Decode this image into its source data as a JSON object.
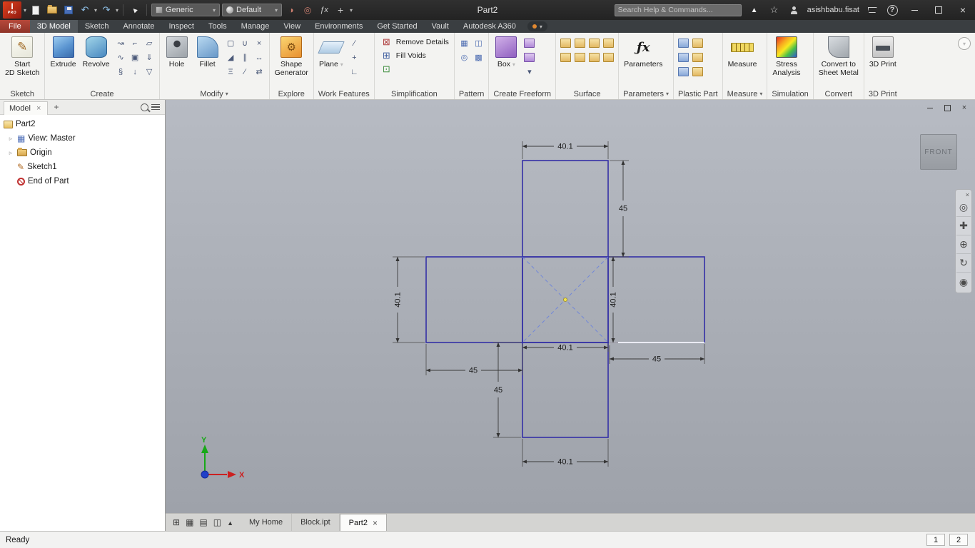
{
  "titlebar": {
    "logo": "I",
    "logo_sub": "PRO",
    "doc_title": "Part2",
    "search_placeholder": "Search Help & Commands...",
    "user_name": "asishbabu.fisat",
    "material_value": "Generic",
    "appearance_value": "Default"
  },
  "icons": {
    "note": "semantic icon names are carried on data-name attributes; glyphs/CSS shapes map them visually",
    "search": "magnifier",
    "menu": "hamburger",
    "close": "x",
    "undo": "arrow-curl-left",
    "redo": "arrow-curl-right",
    "favorites": "star",
    "help": "question-circle",
    "navigation_wheel": "wheel",
    "pan": "cross",
    "zoom": "plus-circle",
    "orbit": "circular-arrow",
    "look_at": "eye-dot"
  },
  "tabs": {
    "file": "File",
    "items": [
      "3D Model",
      "Sketch",
      "Annotate",
      "Inspect",
      "Tools",
      "Manage",
      "View",
      "Environments",
      "Get Started",
      "Vault",
      "Autodesk A360"
    ],
    "active": "3D Model"
  },
  "ribbon": {
    "sketch": {
      "label": "Sketch",
      "start1": "Start",
      "start2": "2D Sketch"
    },
    "create": {
      "label": "Create",
      "extrude": "Extrude",
      "revolve": "Revolve"
    },
    "modify": {
      "label": "Modify",
      "hole": "Hole",
      "fillet": "Fillet"
    },
    "explore": {
      "label": "Explore",
      "sg1": "Shape",
      "sg2": "Generator"
    },
    "work": {
      "label": "Work Features",
      "plane": "Plane"
    },
    "simplify": {
      "label": "Simplification",
      "remove": "Remove Details",
      "fill": "Fill Voids"
    },
    "pattern": {
      "label": "Pattern"
    },
    "freeform": {
      "label": "Create Freeform",
      "box": "Box"
    },
    "surface": {
      "label": "Surface"
    },
    "parameters": {
      "label": "Parameters",
      "btn": "Parameters"
    },
    "plastic": {
      "label": "Plastic Part"
    },
    "measure": {
      "label": "Measure",
      "btn": "Measure"
    },
    "simulation": {
      "label": "Simulation",
      "s1": "Stress",
      "s2": "Analysis"
    },
    "convert": {
      "label": "Convert",
      "c1": "Convert to",
      "c2": "Sheet Metal"
    },
    "print3d": {
      "label": "3D Print",
      "btn": "3D Print"
    }
  },
  "browser": {
    "tab_label": "Model",
    "tree": [
      {
        "label": "Part2"
      },
      {
        "label": "View: Master"
      },
      {
        "label": "Origin"
      },
      {
        "label": "Sketch1"
      },
      {
        "label": "End of Part"
      }
    ]
  },
  "viewport": {
    "viewcube": "FRONT",
    "dims": {
      "top": "40.1",
      "right_top": "45",
      "left": "40.1",
      "center": "40.1",
      "left_bottom": "45",
      "right_inner": "40.1",
      "right_bottom": "45",
      "bottom_v": "45",
      "bottom": "40.1"
    },
    "axes": {
      "x": "X",
      "y": "Y"
    }
  },
  "doc_tabs": {
    "home": "My Home",
    "block": "Block.ipt",
    "part2": "Part2",
    "active": "Part2"
  },
  "status": {
    "ready": "Ready",
    "n1": "1",
    "n2": "2"
  }
}
